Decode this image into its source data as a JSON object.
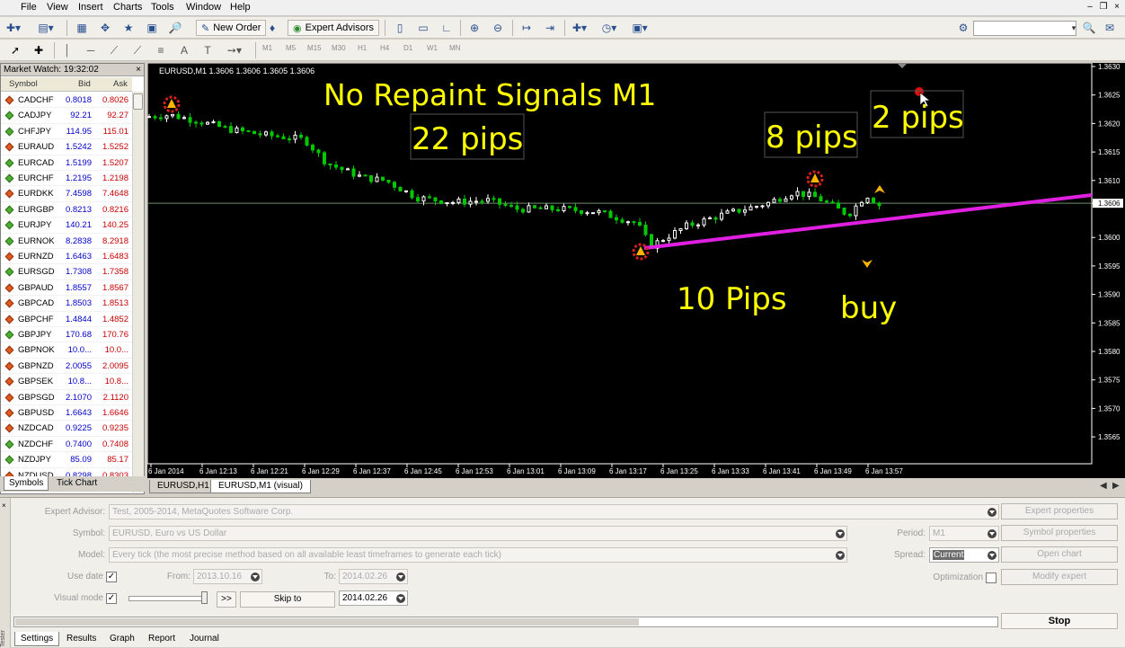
{
  "menu": [
    "File",
    "View",
    "Insert",
    "Charts",
    "Tools",
    "Window",
    "Help"
  ],
  "toolbar": {
    "new_order": "New Order",
    "expert_advisors": "Expert Advisors"
  },
  "timeframes": [
    "M1",
    "M5",
    "M15",
    "M30",
    "H1",
    "H4",
    "D1",
    "W1",
    "MN"
  ],
  "market_watch": {
    "title": "Market Watch: 19:32:02",
    "columns": [
      "Symbol",
      "Bid",
      "Ask"
    ],
    "rows": [
      {
        "symbol": "CADCHF",
        "bid": "0.8018",
        "ask": "0.8026",
        "dir": "down"
      },
      {
        "symbol": "CADJPY",
        "bid": "92.21",
        "ask": "92.27",
        "dir": "up"
      },
      {
        "symbol": "CHFJPY",
        "bid": "114.95",
        "ask": "115.01",
        "dir": "up"
      },
      {
        "symbol": "EURAUD",
        "bid": "1.5242",
        "ask": "1.5252",
        "dir": "down"
      },
      {
        "symbol": "EURCAD",
        "bid": "1.5199",
        "ask": "1.5207",
        "dir": "up"
      },
      {
        "symbol": "EURCHF",
        "bid": "1.2195",
        "ask": "1.2198",
        "dir": "up"
      },
      {
        "symbol": "EURDKK",
        "bid": "7.4598",
        "ask": "7.4648",
        "dir": "down"
      },
      {
        "symbol": "EURGBP",
        "bid": "0.8213",
        "ask": "0.8216",
        "dir": "up"
      },
      {
        "symbol": "EURJPY",
        "bid": "140.21",
        "ask": "140.25",
        "dir": "up"
      },
      {
        "symbol": "EURNOK",
        "bid": "8.2838",
        "ask": "8.2918",
        "dir": "up"
      },
      {
        "symbol": "EURNZD",
        "bid": "1.6463",
        "ask": "1.6483",
        "dir": "down"
      },
      {
        "symbol": "EURSGD",
        "bid": "1.7308",
        "ask": "1.7358",
        "dir": "up"
      },
      {
        "symbol": "GBPAUD",
        "bid": "1.8557",
        "ask": "1.8567",
        "dir": "down"
      },
      {
        "symbol": "GBPCAD",
        "bid": "1.8503",
        "ask": "1.8513",
        "dir": "down"
      },
      {
        "symbol": "GBPCHF",
        "bid": "1.4844",
        "ask": "1.4852",
        "dir": "down"
      },
      {
        "symbol": "GBPJPY",
        "bid": "170.68",
        "ask": "170.76",
        "dir": "up"
      },
      {
        "symbol": "GBPNOK",
        "bid": "10.0...",
        "ask": "10.0...",
        "dir": "down"
      },
      {
        "symbol": "GBPNZD",
        "bid": "2.0055",
        "ask": "2.0095",
        "dir": "down"
      },
      {
        "symbol": "GBPSEK",
        "bid": "10.8...",
        "ask": "10.8...",
        "dir": "down"
      },
      {
        "symbol": "GBPSGD",
        "bid": "2.1070",
        "ask": "2.1120",
        "dir": "down"
      },
      {
        "symbol": "GBPUSD",
        "bid": "1.6643",
        "ask": "1.6646",
        "dir": "down"
      },
      {
        "symbol": "NZDCAD",
        "bid": "0.9225",
        "ask": "0.9235",
        "dir": "down"
      },
      {
        "symbol": "NZDCHF",
        "bid": "0.7400",
        "ask": "0.7408",
        "dir": "up"
      },
      {
        "symbol": "NZDJPY",
        "bid": "85.09",
        "ask": "85.17",
        "dir": "up"
      },
      {
        "symbol": "NZDUSD",
        "bid": "0.8298",
        "ask": "0.8303",
        "dir": "down"
      }
    ],
    "tabs": [
      "Symbols",
      "Tick Chart"
    ]
  },
  "chart": {
    "header": "EURUSD,M1  1.3606 1.3606 1.3605 1.3606",
    "annotations": {
      "title": "No Repaint Signals  M1",
      "pips22": "22 pips",
      "pips8": "8 pips",
      "pips2": "2 pips",
      "pips10": "10 Pips",
      "buy": "buy"
    },
    "price_labels": [
      "1.3630",
      "1.3625",
      "1.3620",
      "1.3615",
      "1.3610",
      "1.3606",
      "1.3600",
      "1.3595",
      "1.3590",
      "1.3585",
      "1.3580",
      "1.3575",
      "1.3570",
      "1.3565"
    ],
    "time_labels": [
      "6 Jan 2014",
      "6 Jan 12:13",
      "6 Jan 12:21",
      "6 Jan 12:29",
      "6 Jan 12:37",
      "6 Jan 12:45",
      "6 Jan 12:53",
      "6 Jan 13:01",
      "6 Jan 13:09",
      "6 Jan 13:17",
      "6 Jan 13:25",
      "6 Jan 13:33",
      "6 Jan 13:41",
      "6 Jan 13:49",
      "6 Jan 13:57"
    ],
    "colors": {
      "bull": "#ffffff",
      "bear": "#00c800",
      "trendline": "#e020e0",
      "text": "#ffff00",
      "signal": "#ffb400"
    },
    "tabs": [
      "EURUSD,H1",
      "EURUSD,M1 (visual)"
    ]
  },
  "tester": {
    "labels": {
      "expert_advisor": "Expert Advisor:",
      "symbol": "Symbol:",
      "model": "Model:",
      "use_date": "Use date",
      "from": "From:",
      "to": "To:",
      "visual_mode": "Visual mode",
      "period": "Period:",
      "spread": "Spread:",
      "optimization": "Optimization"
    },
    "values": {
      "expert_advisor": "Test, 2005-2014, MetaQuotes Software Corp.",
      "symbol": "EURUSD, Euro vs US Dollar",
      "model": "Every tick (the most precise method based on all available least timeframes to generate each tick)",
      "from": "2013.10.16",
      "to": "2014.02.26",
      "skip_to_date": "2014.02.26",
      "period": "M1",
      "spread": "Current"
    },
    "buttons": {
      "expert_properties": "Expert properties",
      "symbol_properties": "Symbol properties",
      "open_chart": "Open chart",
      "modify_expert": "Modify expert",
      "skip_to": "Skip to",
      "fast_forward": ">>",
      "stop": "Stop"
    },
    "tabs": [
      "Settings",
      "Results",
      "Graph",
      "Report",
      "Journal"
    ]
  }
}
